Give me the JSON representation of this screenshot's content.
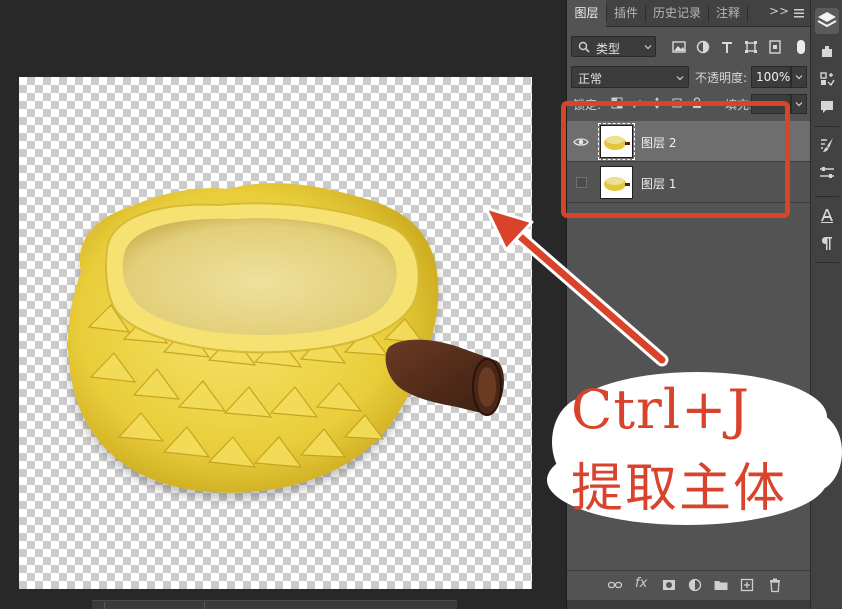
{
  "panel": {
    "tabs": [
      {
        "label": "图层",
        "active": true
      },
      {
        "label": "插件",
        "active": false
      },
      {
        "label": "历史记录",
        "active": false
      },
      {
        "label": "注释",
        "active": false
      }
    ],
    "more_label": ">>",
    "filter": {
      "kind_label": "类型",
      "icons": [
        "image-filter-icon",
        "adjustment-filter-icon",
        "type-filter-icon",
        "shape-filter-icon",
        "smart-object-filter-icon"
      ]
    },
    "blend_mode": "正常",
    "opacity_label": "不透明度:",
    "opacity_value": "100%",
    "lock_label": "锁定:",
    "fill_label": "填充:",
    "layers": [
      {
        "name": "图层 2",
        "visible": true,
        "selected": true
      },
      {
        "name": "图层 1",
        "visible": false,
        "selected": false
      }
    ],
    "footer_icons": [
      "link-layers-icon",
      "fx-icon",
      "add-mask-icon",
      "adjustment-layer-icon",
      "new-group-icon",
      "new-layer-icon",
      "delete-layer-icon"
    ],
    "footer_fx_label": "fx"
  },
  "callout": {
    "line1": "Ctrl+J",
    "line2": "提取主体"
  },
  "colors": {
    "annotation_red": "#d9422b",
    "panel_bg": "#535353",
    "workspace_bg": "#282828",
    "selected_layer": "#6e6e6e"
  }
}
